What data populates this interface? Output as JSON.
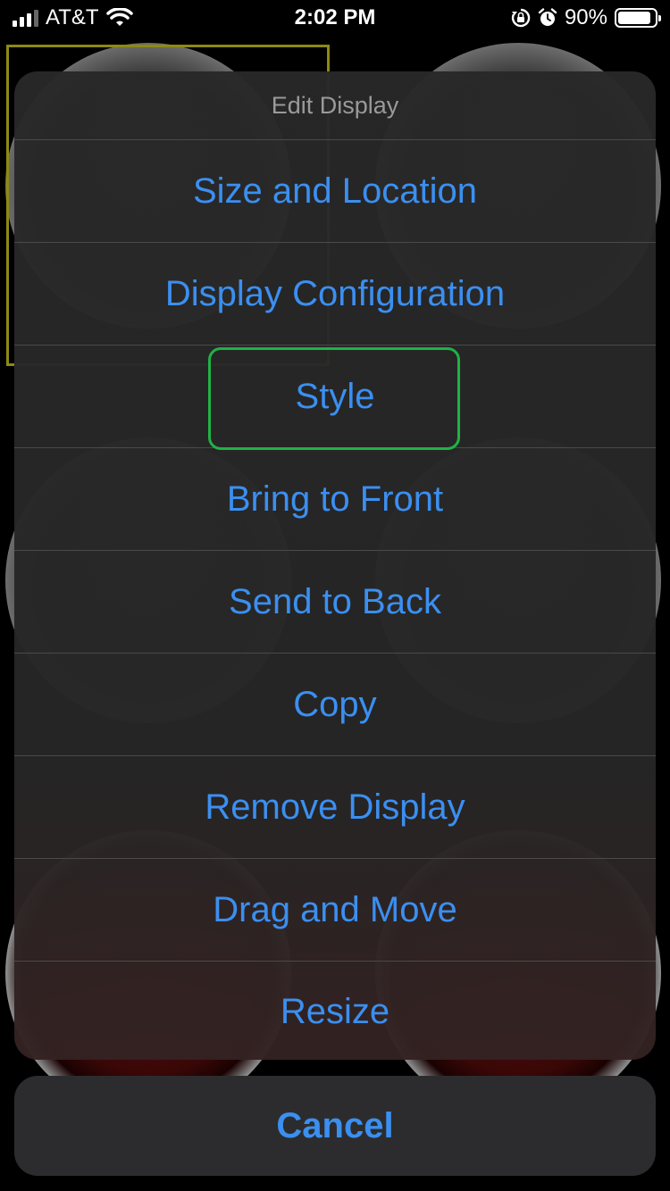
{
  "status_bar": {
    "carrier": "AT&T",
    "time": "2:02 PM",
    "battery": "90%",
    "battery_level": 0.9,
    "icons": [
      "signal-icon",
      "wifi-icon",
      "orientation-lock-icon",
      "alarm-icon",
      "battery-icon"
    ]
  },
  "action_sheet": {
    "title": "Edit Display",
    "items": [
      {
        "label": "Size and Location"
      },
      {
        "label": "Display Configuration"
      },
      {
        "label": "Style",
        "focused": true
      },
      {
        "label": "Bring to Front"
      },
      {
        "label": "Send to Back"
      },
      {
        "label": "Copy"
      },
      {
        "label": "Remove Display"
      },
      {
        "label": "Drag and Move"
      },
      {
        "label": "Resize"
      }
    ],
    "cancel_label": "Cancel"
  },
  "colors": {
    "accent": "#3b8ff0",
    "focus": "#1fb245",
    "title": "#9a9a9a"
  }
}
